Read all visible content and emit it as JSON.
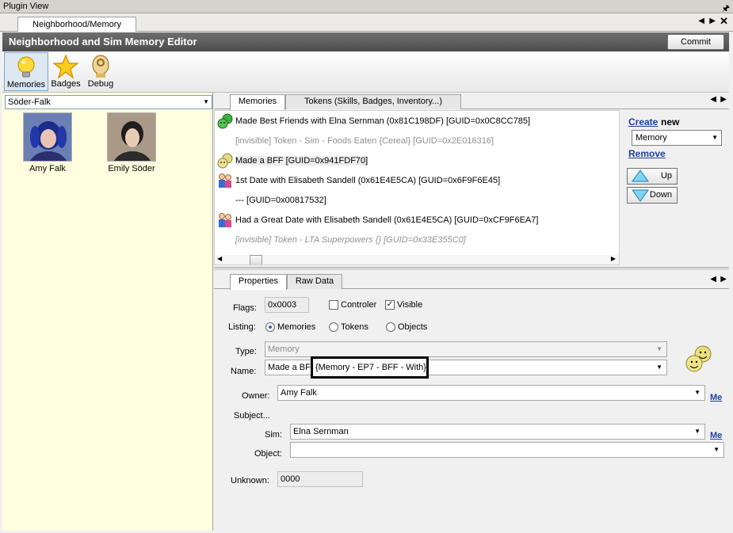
{
  "plugin_view": {
    "title": "Plugin View"
  },
  "top_tabs": {
    "active": "Neighborhood/Memory"
  },
  "editor": {
    "title": "Neighborhood and Sim Memory Editor",
    "commit_label": "Commit"
  },
  "toolbar": {
    "memories": "Memories",
    "badges": "Badges",
    "debug": "Debug"
  },
  "family": {
    "selected": "Söder-Falk"
  },
  "sims": [
    {
      "name": "Amy Falk"
    },
    {
      "name": "Emily Söder"
    }
  ],
  "memory_tabs": {
    "memories": "Memories",
    "tokens": "Tokens (Skills, Badges, Inventory...)"
  },
  "memories": [
    {
      "text": "Made Best Friends with Elna Sernman (0x81C198DF) [GUID=0x0C8CC785]",
      "icon": "smiley-pair-green-icon"
    },
    {
      "text": "[invisible] Token - Sim - Foods Eaten {Cereal} [GUID=0x2E016316]",
      "icon": ""
    },
    {
      "text": "Made a BFF [GUID=0x941FDF70]",
      "icon": "smiley-pair-icon"
    },
    {
      "text": "1st Date with Elisabeth Sandell (0x61E4E5CA) [GUID=0x6F9F6E45]",
      "icon": "couple-icon"
    },
    {
      "text": "--- [GUID=0x00817532]",
      "icon": ""
    },
    {
      "text": "Had a Great Date with Elisabeth Sandell (0x61E4E5CA) [GUID=0xCF9F6EA7]",
      "icon": "couple-icon"
    },
    {
      "text": "[invisible] Token - LTA Superpowers {} [GUID=0x33E355C0]",
      "icon": ""
    }
  ],
  "create": {
    "link": "Create",
    "new": "new",
    "type_selected": "Memory",
    "remove": "Remove",
    "up": "Up",
    "down": "Down"
  },
  "prop_tabs": {
    "properties": "Properties",
    "raw": "Raw Data"
  },
  "properties": {
    "flags_label": "Flags:",
    "flags_value": "0x0003",
    "controler_label": "Controler",
    "visible_label": "Visible",
    "listing_label": "Listing:",
    "listing_memories": "Memories",
    "listing_tokens": "Tokens",
    "listing_objects": "Objects",
    "type_label": "Type:",
    "type_value": "Memory",
    "name_label": "Name:",
    "name_value": "Made a BFF",
    "name_highlight": "{Memory - EP7 - BFF - With}",
    "owner_label": "Owner:",
    "owner_value": "Amy Falk",
    "me1": "Me",
    "subject_label": "Subject...",
    "sim_label": "Sim:",
    "sim_value": "Elna Sernman",
    "me2": "Me",
    "object_label": "Object:",
    "object_value": "",
    "unknown_label": "Unknown:",
    "unknown_value": "0000"
  }
}
